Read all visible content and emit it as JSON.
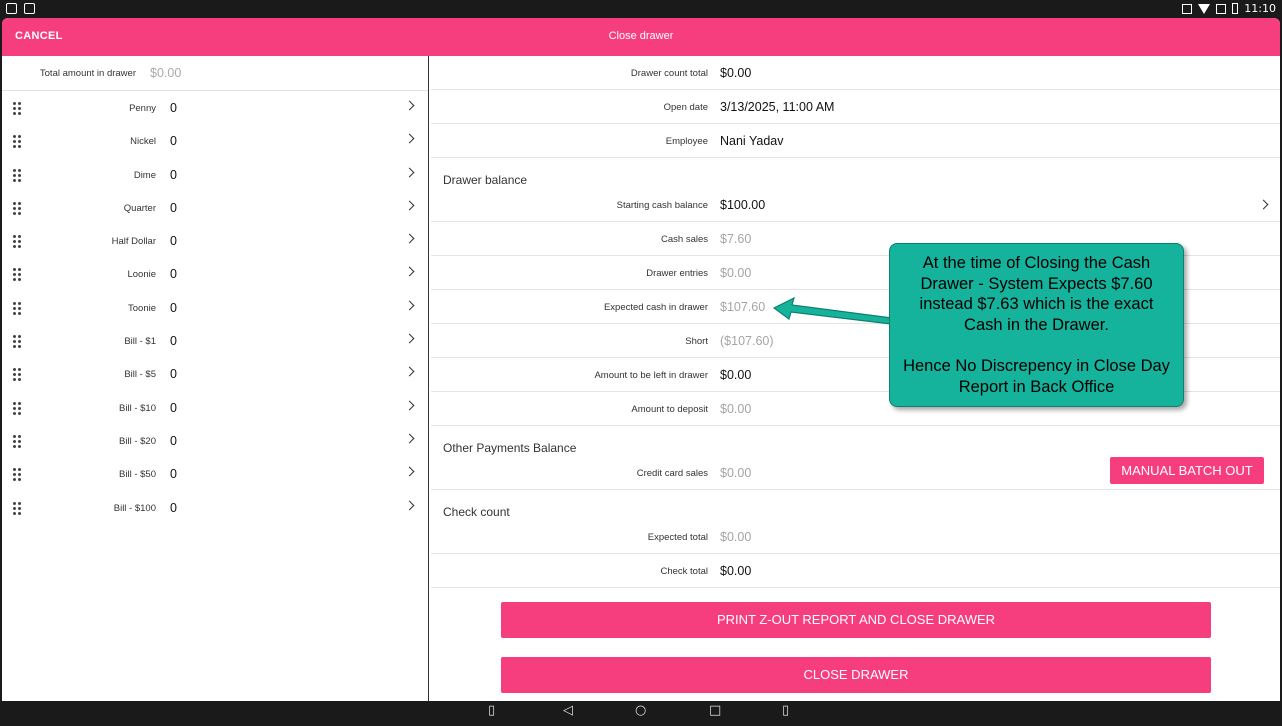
{
  "status_bar": {
    "time": "11:10",
    "left_icons": [
      "notification-icon",
      "message-icon"
    ],
    "right_icons": [
      "cast-icon",
      "wifi-icon",
      "signal-icon",
      "battery-icon"
    ]
  },
  "header": {
    "cancel_label": "CANCEL",
    "title": "Close drawer",
    "color": "#f63d7e"
  },
  "left_panel": {
    "total_label": "Total amount in drawer",
    "total_value": "$0.00",
    "denominations": [
      {
        "label": "Penny",
        "count": "0"
      },
      {
        "label": "Nickel",
        "count": "0"
      },
      {
        "label": "Dime",
        "count": "0"
      },
      {
        "label": "Quarter",
        "count": "0"
      },
      {
        "label": "Half Dollar",
        "count": "0"
      },
      {
        "label": "Loonie",
        "count": "0"
      },
      {
        "label": "Toonie",
        "count": "0"
      },
      {
        "label": "Bill - $1",
        "count": "0"
      },
      {
        "label": "Bill - $5",
        "count": "0"
      },
      {
        "label": "Bill - $10",
        "count": "0"
      },
      {
        "label": "Bill - $20",
        "count": "0"
      },
      {
        "label": "Bill - $50",
        "count": "0"
      },
      {
        "label": "Bill - $100",
        "count": "0"
      }
    ]
  },
  "right_panel": {
    "summary": [
      {
        "label": "Drawer count total",
        "value": "$0.00"
      },
      {
        "label": "Open date",
        "value": "3/13/2025, 11:00 AM"
      },
      {
        "label": "Employee",
        "value": "Nani Yadav"
      }
    ],
    "drawer_balance": {
      "title": "Drawer balance",
      "rows": [
        {
          "label": "Starting cash balance",
          "value": "$100.00"
        },
        {
          "label": "Cash sales",
          "value": "$7.60"
        },
        {
          "label": "Drawer entries",
          "value": "$0.00"
        },
        {
          "label": "Expected cash in drawer",
          "value": "$107.60"
        },
        {
          "label": "Short",
          "value": "($107.60)"
        },
        {
          "label": "Amount to be left in drawer",
          "value": "$0.00"
        },
        {
          "label": "Amount to deposit",
          "value": "$0.00"
        }
      ]
    },
    "other_payments": {
      "title": "Other Payments Balance",
      "rows": [
        {
          "label": "Credit card sales",
          "value": "$0.00"
        }
      ],
      "manual_batch_label": "MANUAL BATCH OUT"
    },
    "check_count": {
      "title": "Check count",
      "rows": [
        {
          "label": "Expected total",
          "value": "$0.00"
        },
        {
          "label": "Check total",
          "value": "$0.00"
        }
      ]
    },
    "print_button_label": "PRINT Z-OUT REPORT AND CLOSE DRAWER",
    "close_button_label": "CLOSE DRAWER"
  },
  "annotation": {
    "line1": "At the time of Closing the Cash Drawer - System Expects $7.60 instead $7.63 which is the exact Cash in the Drawer.",
    "line2": "Hence No Discrepency in Close Day Report in Back Office",
    "color": "#16b39c"
  },
  "nav_bar": {
    "icons": [
      "volume-down-icon",
      "back-icon",
      "home-icon",
      "recents-icon",
      "volume-up-icon"
    ]
  }
}
